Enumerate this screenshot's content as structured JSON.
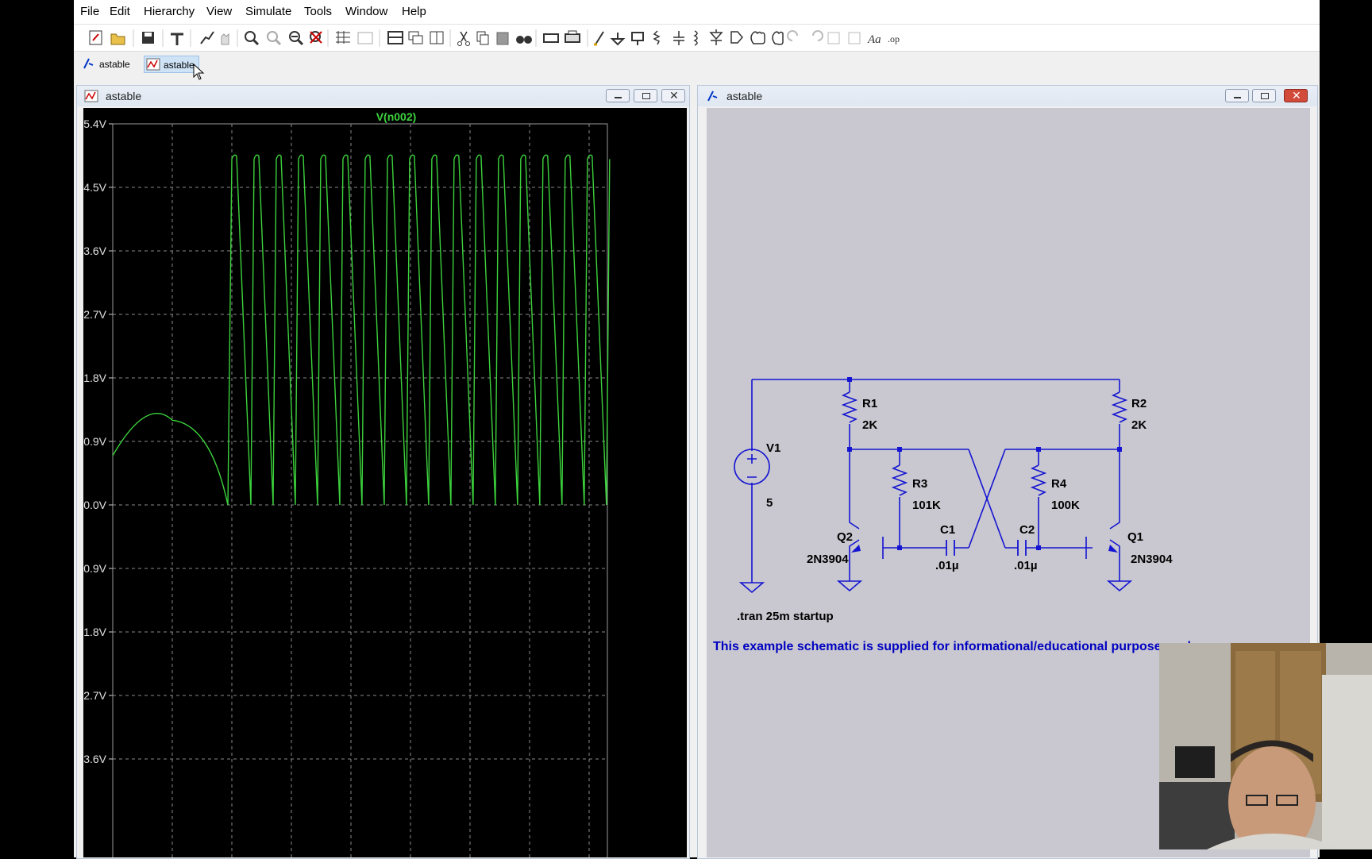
{
  "menubar": {
    "items": [
      "File",
      "Edit",
      "Hierarchy",
      "View",
      "Simulate",
      "Tools",
      "Window",
      "Help"
    ]
  },
  "tabs": [
    {
      "label": "astable",
      "kind": "schematic"
    },
    {
      "label": "astable",
      "kind": "waveform",
      "active": true
    }
  ],
  "waveform_window": {
    "title": "astable",
    "trace_label": "V(n002)"
  },
  "schematic_window": {
    "title": "astable",
    "components": {
      "R1": {
        "name": "R1",
        "value": "2K"
      },
      "R2": {
        "name": "R2",
        "value": "2K"
      },
      "R3": {
        "name": "R3",
        "value": "101K"
      },
      "R4": {
        "name": "R4",
        "value": "100K"
      },
      "C1": {
        "name": "C1",
        "value": ".01µ"
      },
      "C2": {
        "name": "C2",
        "value": ".01µ"
      },
      "Q1": {
        "name": "Q1",
        "value": "2N3904"
      },
      "Q2": {
        "name": "Q2",
        "value": "2N3904"
      },
      "V1": {
        "name": "V1",
        "value": "5"
      }
    },
    "directive": ".tran 25m startup",
    "note": "This example schematic is supplied for informational/educational purposes only"
  },
  "colors": {
    "trace": "#3cd23c",
    "wire": "#1414d2",
    "schematic_bg": "#c9c8d0",
    "note_text": "#0000c0"
  },
  "chart_data": {
    "type": "line",
    "title": "V(n002)",
    "ylim": [
      -3.6,
      5.4
    ],
    "y_ticks": [
      "5.4V",
      "4.5V",
      "3.6V",
      "2.7V",
      "1.8V",
      "0.9V",
      "0.0V",
      "-0.9V",
      "-1.8V",
      "-2.7V",
      "-3.6V"
    ],
    "grid": true,
    "series": [
      {
        "name": "V(n002)",
        "description_values": {
          "initial_hump_peak": 1.2,
          "oscillation_high": 4.9,
          "oscillation_low": 0.0,
          "cycles_visible": 17
        }
      }
    ]
  }
}
